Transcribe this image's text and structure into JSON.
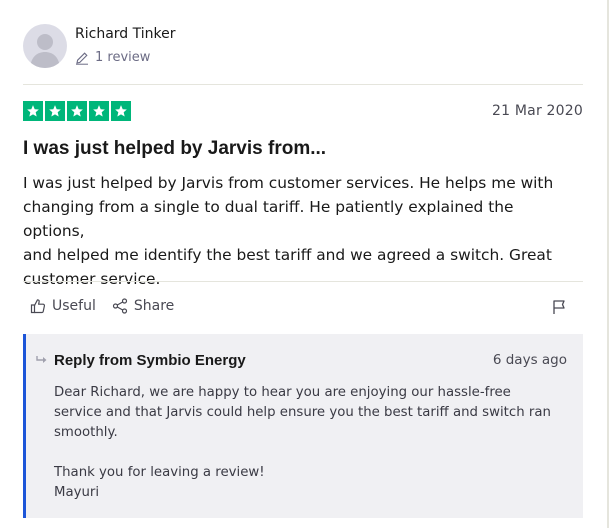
{
  "reviewer": {
    "name": "Richard Tinker",
    "review_count": "1 review"
  },
  "review": {
    "rating": 5,
    "rating_max": 5,
    "star_color": "#00b67a",
    "date": "21 Mar 2020",
    "title": "I was just helped by Jarvis from...",
    "body_lines": [
      "I was just helped by Jarvis from customer services. He helps me with",
      "changing from a single to dual tariff. He patiently explained the options,",
      "and helped me identify the best tariff and we agreed a switch. Great",
      "customer service."
    ]
  },
  "actions": {
    "useful_label": "Useful",
    "useful_icon": "thumbs-up-icon",
    "share_label": "Share",
    "share_icon": "share-icon",
    "report_icon": "flag-icon"
  },
  "reply": {
    "from": "Reply from Symbio Energy",
    "date": "6 days ago",
    "accent_color": "#1c55d8",
    "lines": [
      "Dear Richard, we are happy to hear you are enjoying our hassle-free",
      "service and that Jarvis could help ensure you the best tariff and switch ran",
      "smoothly.",
      "Thank you for leaving a review!",
      "Mayuri"
    ]
  }
}
